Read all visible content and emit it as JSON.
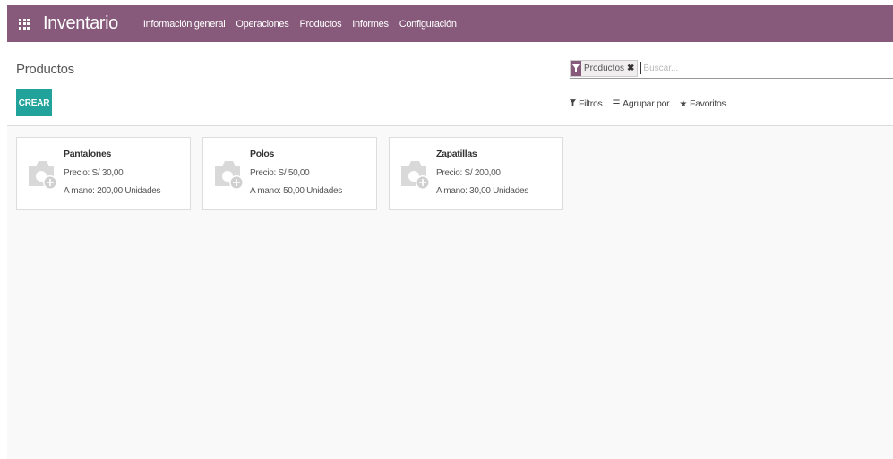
{
  "navbar": {
    "app_title": "Inventario",
    "menu": [
      "Información general",
      "Operaciones",
      "Productos",
      "Informes",
      "Configuración"
    ],
    "color": "#875a7b"
  },
  "control_panel": {
    "breadcrumb": "Productos",
    "create_label": "CREAR",
    "create_color": "#21a39b",
    "search": {
      "facet_label": "Productos",
      "facet_icon": "filter-icon",
      "placeholder": "Buscar..."
    },
    "filters_label": "Filtros",
    "group_by_label": "Agrupar por",
    "favorites_label": "Favoritos"
  },
  "products": [
    {
      "name": "Pantalones",
      "price": "Precio: S/ 30,00",
      "on_hand": "A mano: 200,00 Unidades"
    },
    {
      "name": "Polos",
      "price": "Precio: S/ 50,00",
      "on_hand": "A mano: 50,00 Unidades"
    },
    {
      "name": "Zapatillas",
      "price": "Precio: S/ 200,00",
      "on_hand": "A mano: 30,00 Unidades"
    }
  ]
}
